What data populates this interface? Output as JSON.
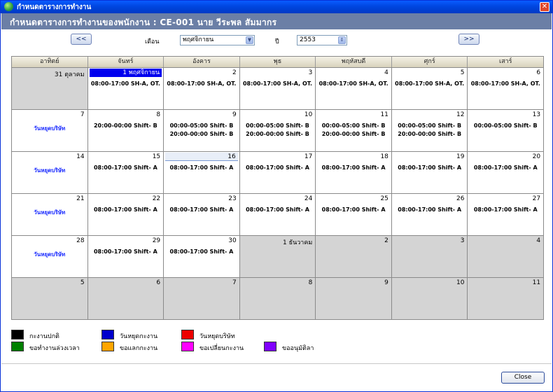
{
  "window": {
    "title": "กำหนดตารางการทำงาน",
    "close_glyph": "✕"
  },
  "header": {
    "text": "กำหนดตารางการทำงานของพนักงาน  :  CE-001  นาย วีระพล สัมมากร"
  },
  "nav": {
    "prev_label": "<<",
    "next_label": ">>",
    "month_label": "เดือน",
    "month_value": "พฤศจิกายน",
    "year_label": "ปี",
    "year_value": "2553"
  },
  "weekdays": [
    "อาทิตย์",
    "จันทร์",
    "อังคาร",
    "พุธ",
    "พฤหัสบดี",
    "ศุกร์",
    "เสาร์"
  ],
  "weeks": [
    [
      {
        "num": "31 ตุลาคม",
        "other": true,
        "shifts": []
      },
      {
        "num": "1 พฤศจิกายน",
        "highlight": true,
        "shifts": [
          "08:00-17:00 SH-A, OT."
        ]
      },
      {
        "num": "2",
        "shifts": [
          "08:00-17:00 SH-A, OT."
        ]
      },
      {
        "num": "3",
        "shifts": [
          "08:00-17:00 SH-A, OT."
        ]
      },
      {
        "num": "4",
        "shifts": [
          "08:00-17:00 SH-A, OT."
        ]
      },
      {
        "num": "5",
        "shifts": [
          "08:00-17:00 SH-A, OT."
        ]
      },
      {
        "num": "6",
        "shifts": [
          "08:00-17:00 SH-A, OT."
        ]
      }
    ],
    [
      {
        "num": "7",
        "holiday": "วันหยุดบริษัท",
        "shifts": []
      },
      {
        "num": "8",
        "shifts": [
          "20:00-00:00 Shift- B"
        ]
      },
      {
        "num": "9",
        "shifts": [
          "00:00-05:00 Shift- B",
          "20:00-00:00 Shift- B"
        ]
      },
      {
        "num": "10",
        "shifts": [
          "00:00-05:00 Shift- B",
          "20:00-00:00 Shift- B"
        ]
      },
      {
        "num": "11",
        "shifts": [
          "00:00-05:00 Shift- B",
          "20:00-00:00 Shift- B"
        ]
      },
      {
        "num": "12",
        "shifts": [
          "00:00-05:00 Shift- B",
          "20:00-00:00 Shift- B"
        ]
      },
      {
        "num": "13",
        "shifts": [
          "00:00-05:00 Shift- B"
        ]
      }
    ],
    [
      {
        "num": "14",
        "holiday": "วันหยุดบริษัท",
        "shifts": []
      },
      {
        "num": "15",
        "shifts": [
          "08:00-17:00 Shift- A"
        ]
      },
      {
        "num": "16",
        "today": true,
        "shifts": [
          "08:00-17:00 Shift- A"
        ]
      },
      {
        "num": "17",
        "shifts": [
          "08:00-17:00 Shift- A"
        ]
      },
      {
        "num": "18",
        "shifts": [
          "08:00-17:00 Shift- A"
        ]
      },
      {
        "num": "19",
        "shifts": [
          "08:00-17:00 Shift- A"
        ]
      },
      {
        "num": "20",
        "shifts": [
          "08:00-17:00 Shift- A"
        ]
      }
    ],
    [
      {
        "num": "21",
        "holiday": "วันหยุดบริษัท",
        "shifts": []
      },
      {
        "num": "22",
        "shifts": [
          "08:00-17:00 Shift- A"
        ]
      },
      {
        "num": "23",
        "shifts": [
          "08:00-17:00 Shift- A"
        ]
      },
      {
        "num": "24",
        "shifts": [
          "08:00-17:00 Shift- A"
        ]
      },
      {
        "num": "25",
        "shifts": [
          "08:00-17:00 Shift- A"
        ]
      },
      {
        "num": "26",
        "shifts": [
          "08:00-17:00 Shift- A"
        ]
      },
      {
        "num": "27",
        "shifts": [
          "08:00-17:00 Shift- A"
        ]
      }
    ],
    [
      {
        "num": "28",
        "holiday": "วันหยุดบริษัท",
        "shifts": []
      },
      {
        "num": "29",
        "shifts": [
          "08:00-17:00 Shift- A"
        ]
      },
      {
        "num": "30",
        "shifts": [
          "08:00-17:00 Shift- A"
        ]
      },
      {
        "num": "1 ธันวาคม",
        "other": true,
        "shifts": []
      },
      {
        "num": "2",
        "other": true,
        "shifts": []
      },
      {
        "num": "3",
        "other": true,
        "shifts": []
      },
      {
        "num": "4",
        "other": true,
        "shifts": []
      }
    ],
    [
      {
        "num": "5",
        "other": true,
        "shifts": []
      },
      {
        "num": "6",
        "other": true,
        "shifts": []
      },
      {
        "num": "7",
        "other": true,
        "shifts": []
      },
      {
        "num": "8",
        "other": true,
        "shifts": []
      },
      {
        "num": "9",
        "other": true,
        "shifts": []
      },
      {
        "num": "10",
        "other": true,
        "shifts": []
      },
      {
        "num": "11",
        "other": true,
        "shifts": []
      }
    ]
  ],
  "legend": [
    {
      "label": "กะงานปกติ",
      "color": "#000000"
    },
    {
      "label": "วันหยุดกะงาน",
      "color": "#0000cc"
    },
    {
      "label": "วันหยุดบริษัท",
      "color": "#ee0000"
    },
    {
      "label": "ขอทำงานล่วงเวลา",
      "color": "#008000"
    },
    {
      "label": "ขอแลกกะงาน",
      "color": "#ffa500"
    },
    {
      "label": "ขอเปลี่ยนกะงาน",
      "color": "#ff00ff"
    },
    {
      "label": "ขออนุมัติลา",
      "color": "#8000ff"
    }
  ],
  "footer": {
    "close_label": "Close"
  },
  "colors": {
    "title_bar": "#0a5cff",
    "header_band": "#6b7fa6",
    "highlight": "#0000ee",
    "other_month": "#d4d4d4",
    "holiday_text": "#1a2bff"
  }
}
